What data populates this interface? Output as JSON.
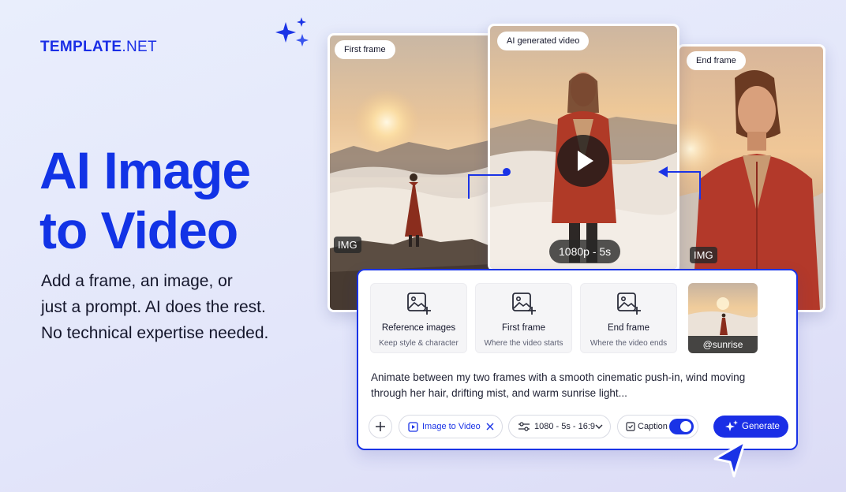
{
  "brand": {
    "name_bold": "TEMPLATE",
    "name_light": ".NET"
  },
  "hero": {
    "line1": "AI Image",
    "line2": "to Video"
  },
  "subtitle": {
    "line1": "Add a frame, an image, or",
    "line2": "just a prompt. AI does the rest.",
    "line3": "No technical expertise needed."
  },
  "frames": {
    "first": {
      "label": "First frame",
      "tag": "IMG"
    },
    "middle": {
      "label": "AI generated video",
      "resolution": "1080p - 5s"
    },
    "end": {
      "label": "End frame",
      "tag": "IMG"
    }
  },
  "panel": {
    "options": [
      {
        "title": "Reference images",
        "desc": "Keep style & character"
      },
      {
        "title": "First frame",
        "desc": "Where the video starts"
      },
      {
        "title": "End frame",
        "desc": "Where the video ends"
      }
    ],
    "thumb_label": "@sunrise",
    "prompt": "Animate between my two frames with a smooth cinematic push-in, wind moving through her hair, drifting mist, and warm sunrise light...",
    "mode_chip": "Image to Video",
    "settings_chip": "1080 - 5s - 16:9",
    "caption_label": "Caption",
    "caption_on": true,
    "generate_label": "Generate"
  },
  "colors": {
    "accent": "#1a2ee6",
    "headline": "#1233e6"
  },
  "icons": [
    "sparkle-icon",
    "image-add-icon",
    "play-icon",
    "plus-icon",
    "video-icon",
    "close-icon",
    "sliders-icon",
    "chevron-down-icon",
    "caption-icon",
    "cursor-icon"
  ]
}
